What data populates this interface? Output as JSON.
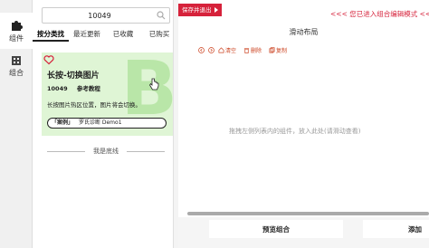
{
  "rail": {
    "items": [
      {
        "label": "组件",
        "icon": "puzzle-icon"
      },
      {
        "label": "组合",
        "icon": "building-icon"
      }
    ]
  },
  "search": {
    "value": "10049"
  },
  "tabs": [
    "按分类找",
    "最近更新",
    "已收藏",
    "已购买"
  ],
  "card": {
    "title": "长按-切换图片",
    "id": "10049",
    "tutorial": "参考教程",
    "description": "长按图片热区位置，图片将会切换。",
    "case_tag": "「案例」",
    "case_name": "罗氏诊断",
    "case_demo": "Demo1",
    "watermark": "B"
  },
  "bottom_line": "我是底线",
  "right": {
    "save_exit": "保存并退出",
    "notice": "<<< 您已进入组合编辑模式 <<<",
    "layout_title": "滑动布局",
    "toolbar": [
      "清空",
      "删除",
      "复制"
    ],
    "drop_hint": "拖拽左侧列表内的组件，放入此处(请滑动查看)",
    "preview_button": "预览组合",
    "add_button": "添加"
  },
  "colors": {
    "accent": "#d6223b",
    "card_bg": "#dff5d5"
  }
}
